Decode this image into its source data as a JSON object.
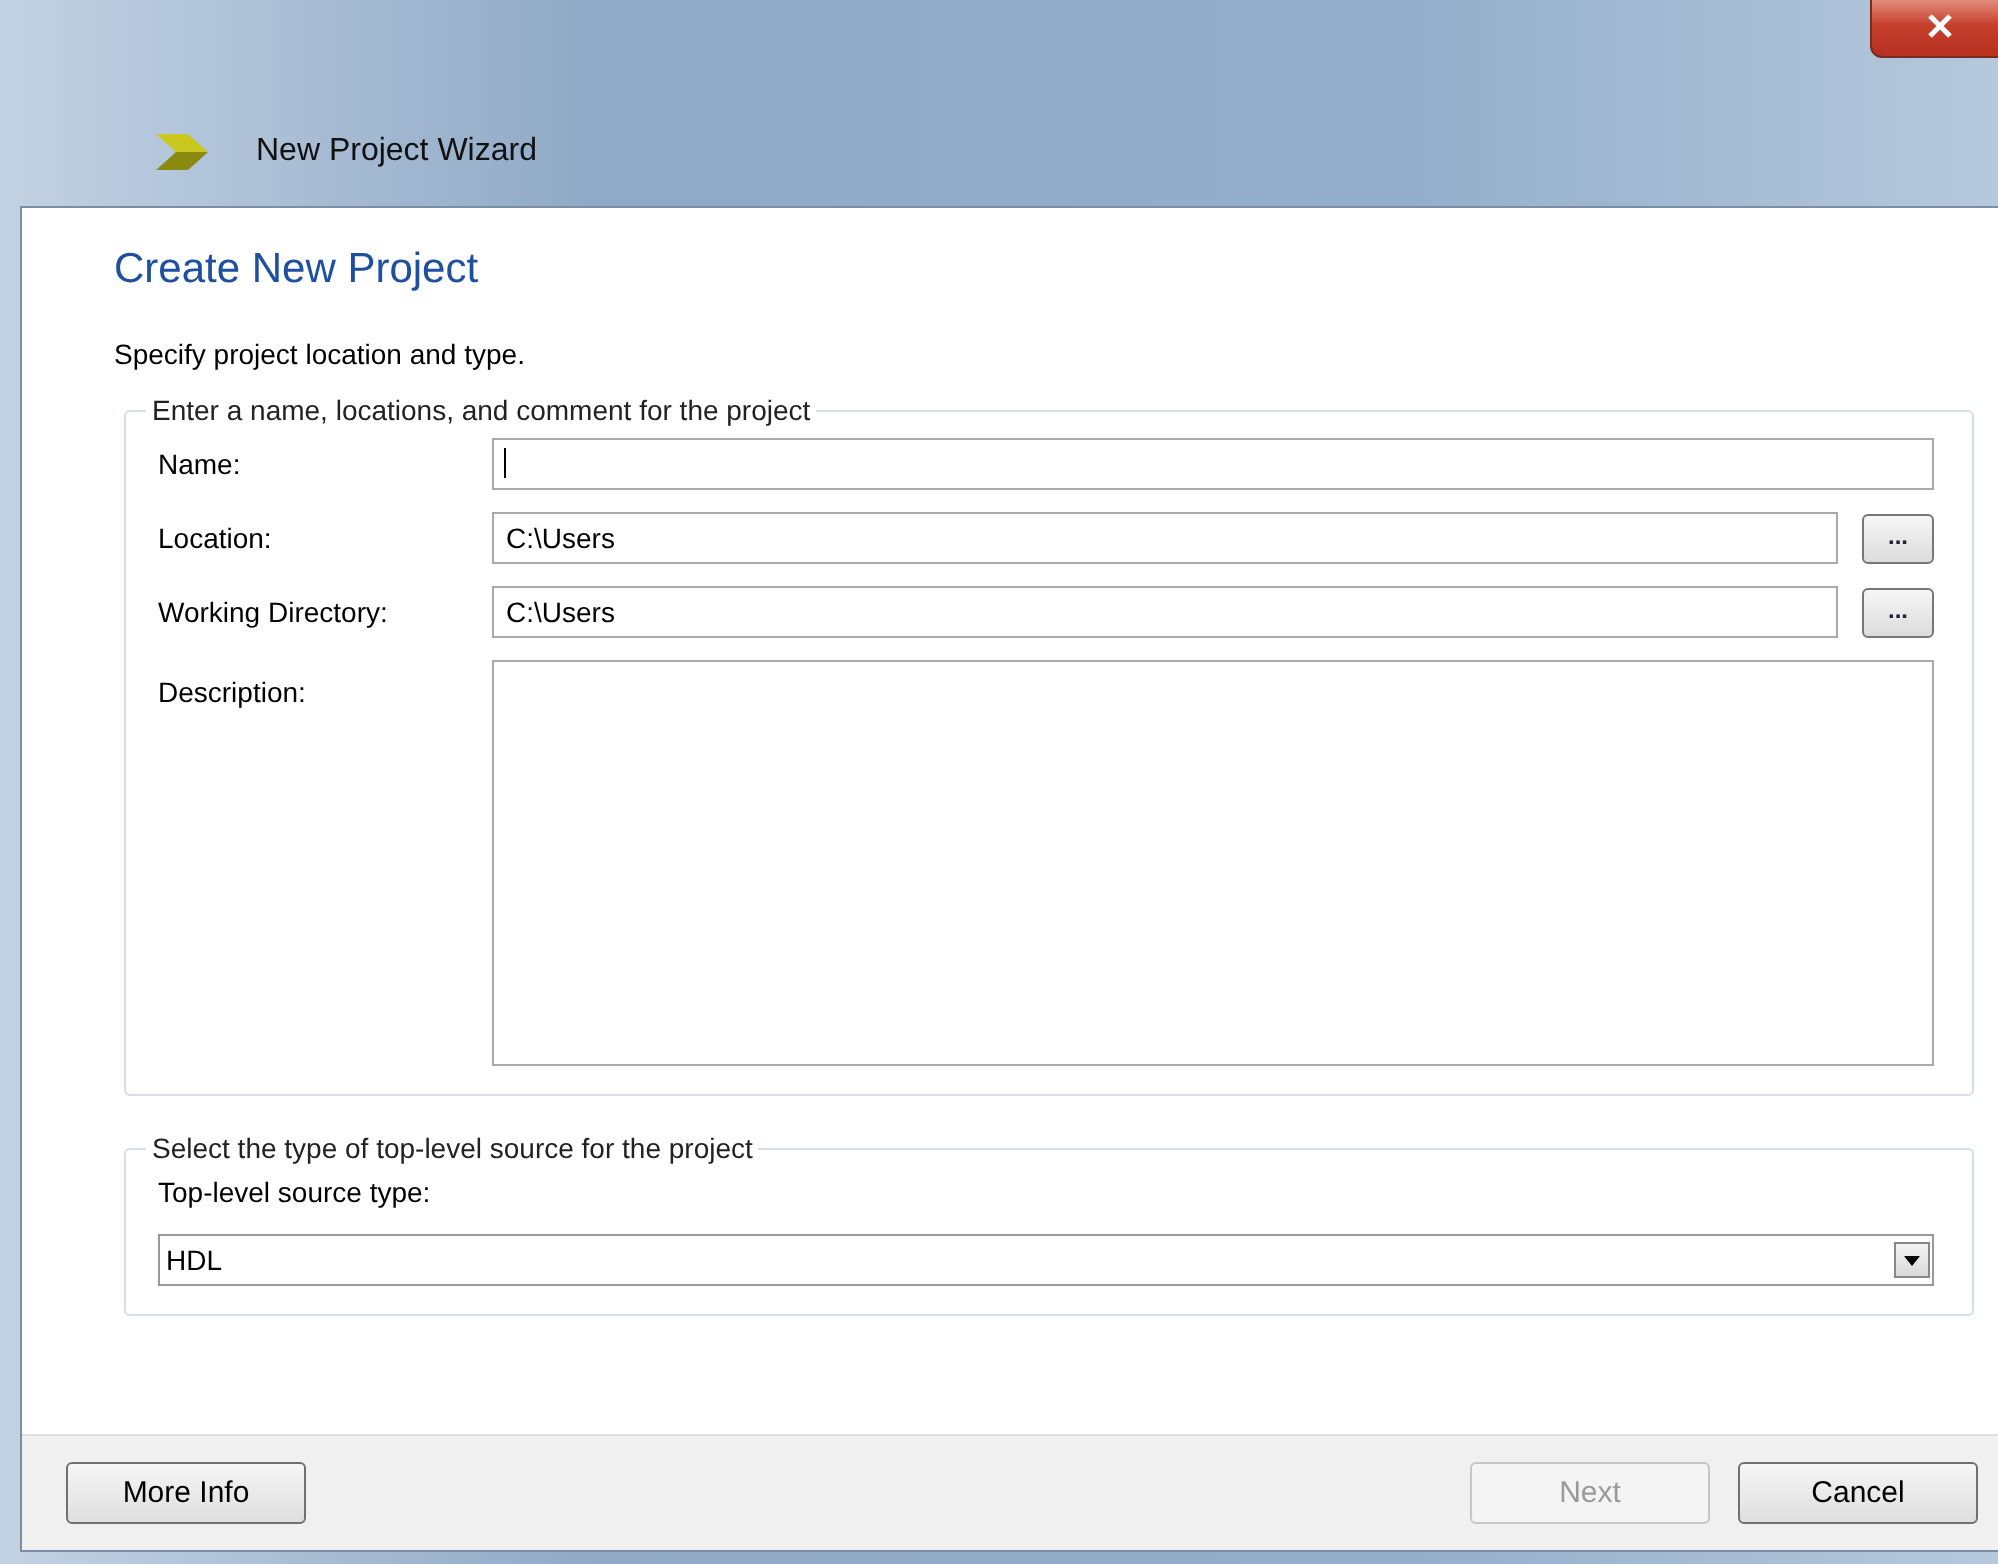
{
  "window": {
    "title": "New Project Wizard"
  },
  "page": {
    "heading": "Create New Project",
    "instruction": "Specify project location and type."
  },
  "project_group": {
    "legend": "Enter a name, locations, and comment for the project",
    "fields": [
      {
        "kind": "text",
        "label": "Name:",
        "focused": true
      },
      {
        "kind": "browse",
        "label": "Location:",
        "value": "C:\\Users",
        "button": "..."
      },
      {
        "kind": "browse",
        "label": "Working Directory:",
        "value": "C:\\Users",
        "button": "..."
      },
      {
        "kind": "multiline",
        "label": "Description:"
      }
    ]
  },
  "source_group": {
    "legend": "Select the type of top-level source for the project",
    "label": "Top-level source type:",
    "value": "HDL"
  },
  "footer": {
    "left_buttons": [
      {
        "label": "More Info",
        "disabled": false
      }
    ],
    "right_buttons": [
      {
        "label": "Next",
        "disabled": true
      },
      {
        "label": "Cancel",
        "disabled": false
      }
    ]
  }
}
